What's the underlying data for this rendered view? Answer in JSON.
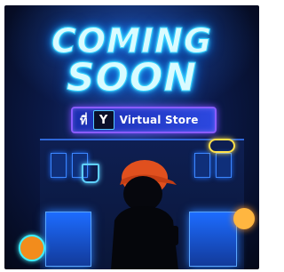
{
  "poster": {
    "headline_line1": "COMING",
    "headline_line2": "SOON",
    "badge_prefix": "ที่",
    "badge_logo_letter": "Y",
    "badge_text": "Virtual Store"
  },
  "colors": {
    "background": "#0b1a4a",
    "neon_cyan": "#4fe3ff",
    "badge_blue": "#2c48e0",
    "badge_border": "#8a5cff",
    "cap_orange": "#e0501e"
  },
  "icons": [
    "avatar-silhouette",
    "storefront",
    "neon-cup-sign",
    "neon-sign",
    "shop-sign"
  ]
}
